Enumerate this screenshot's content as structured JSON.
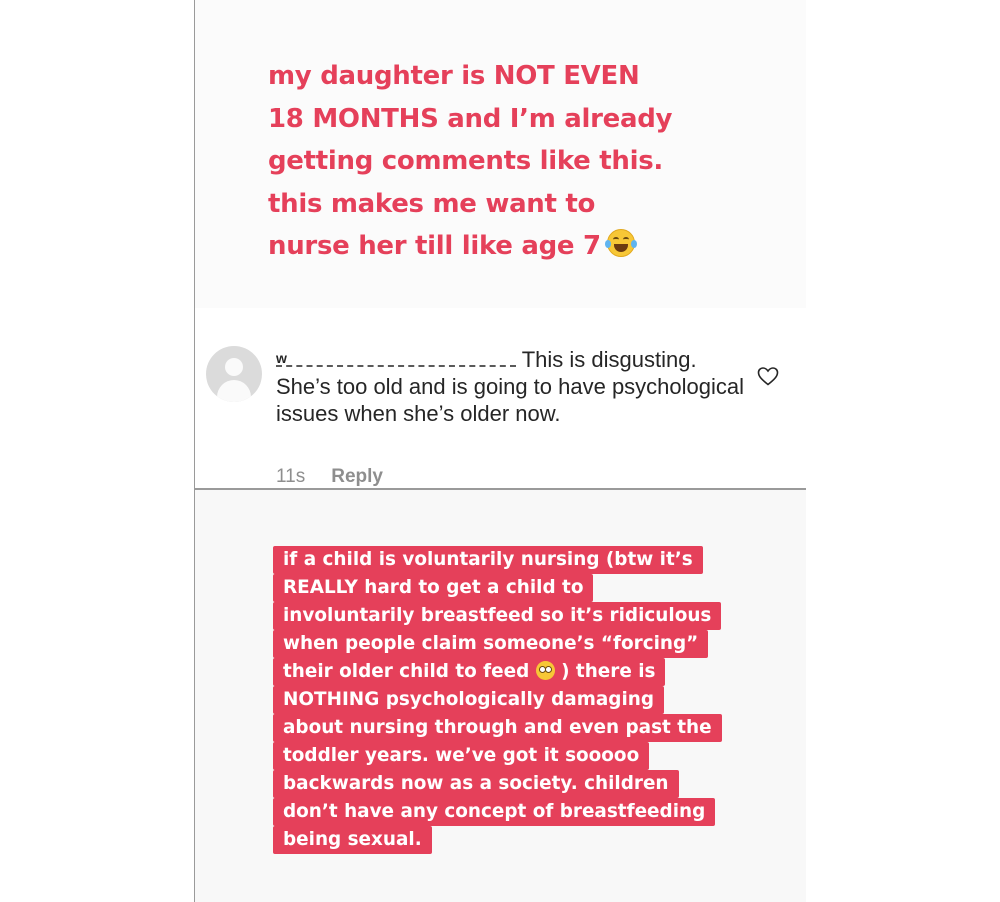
{
  "story_top": {
    "headline_lines": [
      "my daughter is NOT EVEN",
      "18 MONTHS and I’m already",
      "getting comments like this.",
      "this makes me want to",
      "nurse her till like age 7"
    ],
    "emoji": "face-with-tears-of-joy-icon"
  },
  "comment": {
    "username": "w",
    "text_first": "This is disgusting.",
    "text_rest": "She’s too old and is going to have psychological issues when she’s older now.",
    "time": "11s",
    "reply_label": "Reply",
    "like_icon": "heart-outline-icon"
  },
  "story_bottom": {
    "caption_lines": [
      "if a child is voluntarily nursing (btw it’s",
      "REALLY hard to get a child to",
      "involuntarily breastfeed so it’s ridiculous",
      "when people claim someone’s “forcing”",
      "their older child to feed",
      ") there is",
      "NOTHING psychologically damaging",
      "about nursing through and even past the",
      "toddler years. we’ve got it sooooo",
      "backwards now as a society. children",
      "don’t have any concept of breastfeeding",
      "being sexual."
    ],
    "emoji": "face-with-rolling-eyes-icon"
  },
  "colors": {
    "accent_pink": "#e5405a",
    "text_dark": "#262626",
    "meta_gray": "#8e8e8e"
  }
}
